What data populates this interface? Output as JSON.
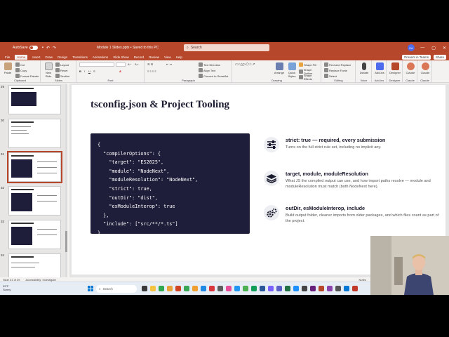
{
  "titlebar": {
    "autosave": "AutoSave",
    "autosave_state": "On",
    "document": "Module 1 Slides.pptx • Saved to this PC",
    "search_placeholder": "Search",
    "user_initials": "EA"
  },
  "menu": {
    "items": [
      "File",
      "Home",
      "Insert",
      "Draw",
      "Design",
      "Transitions",
      "Animations",
      "Slide Show",
      "Record",
      "Review",
      "View",
      "Help"
    ],
    "active": "Home",
    "present_teams": "Present in Teams",
    "share": "Share"
  },
  "ribbon": {
    "clipboard": {
      "paste": "Paste",
      "cut": "Cut",
      "copy": "Copy",
      "format_painter": "Format Painter",
      "label": "Clipboard"
    },
    "slides": {
      "new_slide": "New Slide",
      "reuse": "Reuse Slides",
      "layout": "Layout",
      "reset": "Reset",
      "section": "Section",
      "label": "Slides"
    },
    "font": {
      "label": "Font"
    },
    "paragraph": {
      "text_direction": "Text Direction",
      "align_text": "Align Text",
      "convert_smartart": "Convert to SmartArt",
      "label": "Paragraph"
    },
    "drawing": {
      "arrange": "Arrange",
      "quick_styles": "Quick Styles",
      "shape_fill": "Shape Fill",
      "shape_outline": "Shape Outline",
      "shape_effects": "Shape Effects",
      "label": "Drawing"
    },
    "editing": {
      "find_replace": "Find and Replace",
      "replace_fonts": "Replace Fonts",
      "select": "Select",
      "label": "Editing"
    },
    "voice": {
      "dictate": "Dictate",
      "label": "Voice"
    },
    "addins": {
      "addins": "Add-ins",
      "label": "Add-ins"
    },
    "designer": {
      "designer": "Designer",
      "label": "Designer"
    },
    "claude": {
      "claude1": "Claude",
      "claude2": "Claude",
      "label1": "Claude",
      "label2": "Claude"
    }
  },
  "thumbnails": {
    "numbers": [
      "29",
      "30",
      "31",
      "32",
      "33",
      "34"
    ],
    "selected": "31"
  },
  "slide": {
    "title": "tsconfig.json & Project Tooling",
    "code": [
      "{",
      "  \"compilerOptions\": {",
      "    \"target\": \"ES2025\",",
      "    \"module\": \"NodeNext\",",
      "    \"moduleResolution\": \"NodeNext\",",
      "    \"strict\": true,",
      "    \"outDir\": \"dist\",",
      "    \"esModuleInterop\": true",
      "  },",
      "  \"include\": [\"src/**/*.ts\"]",
      "}"
    ],
    "features": [
      {
        "icon": "sliders-icon",
        "title": "strict: true — required, every submission",
        "desc": "Turns on the full strict rule set, including no implicit any."
      },
      {
        "icon": "layers-icon",
        "title": "target, module, moduleResolution",
        "desc": "What JS the compiled output can use, and how import paths resolve — module and moduleResolution must match (both NodeNext here)."
      },
      {
        "icon": "gears-icon",
        "title": "outDir, esModuleInterop, include",
        "desc": "Build output folder, cleaner imports from older packages, and which files count as part of the project."
      }
    ]
  },
  "statusbar": {
    "slide_of": "Slide 31 of 39",
    "accessibility": "Accessibility: Investigate",
    "notes": "Notes"
  },
  "taskbar": {
    "temp": "39°F",
    "weather": "Sunny",
    "search": "Search"
  },
  "colors": {
    "accent": "#b7472a",
    "code_bg": "#1f1e3a"
  }
}
